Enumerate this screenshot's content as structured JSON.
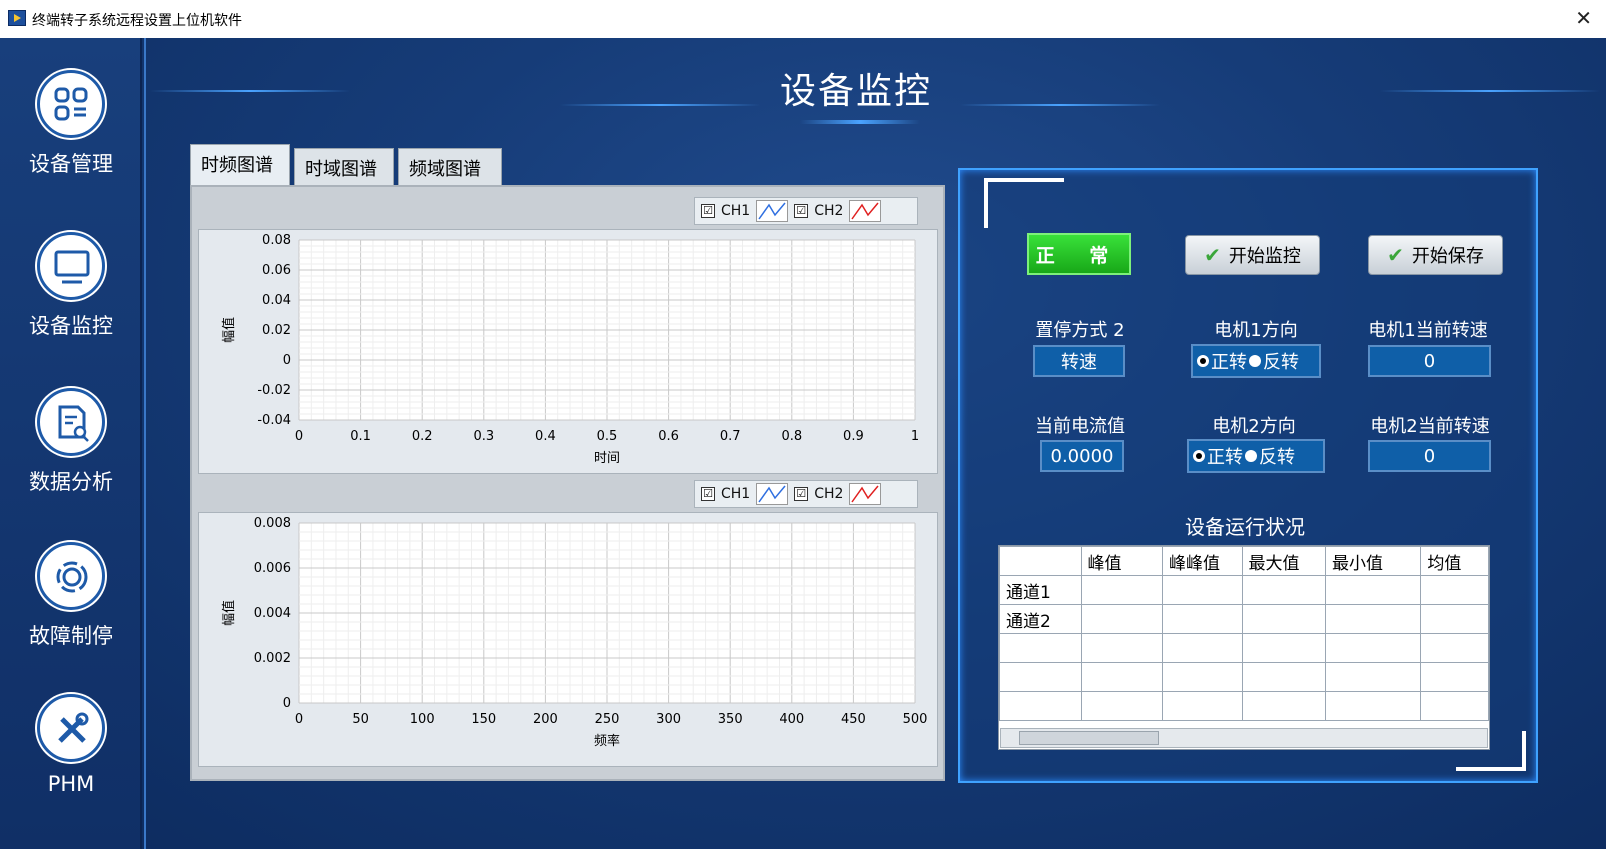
{
  "window": {
    "title": "终端转子系统远程设置上位机软件",
    "close": "✕"
  },
  "sidebar": {
    "items": [
      {
        "label": "设备管理",
        "icon": "apps-grid-icon"
      },
      {
        "label": "设备监控",
        "icon": "monitor-icon"
      },
      {
        "label": "数据分析",
        "icon": "document-search-icon"
      },
      {
        "label": "故障制停",
        "icon": "ring-icon"
      },
      {
        "label": "PHM",
        "icon": "tools-icon"
      }
    ]
  },
  "header": {
    "title": "设备监控"
  },
  "tabs": [
    {
      "label": "时频图谱",
      "active": true
    },
    {
      "label": "时域图谱"
    },
    {
      "label": "频域图谱"
    }
  ],
  "chart_data": [
    {
      "type": "line",
      "title": "",
      "xlabel": "时间",
      "ylabel": "幅值",
      "x_ticks": [
        "0",
        "0.1",
        "0.2",
        "0.3",
        "0.4",
        "0.5",
        "0.6",
        "0.7",
        "0.8",
        "0.9",
        "1"
      ],
      "y_ticks": [
        "0.08",
        "0.06",
        "0.04",
        "0.02",
        "0",
        "-0.02",
        "-0.04"
      ],
      "xlim": [
        0,
        1
      ],
      "ylim": [
        -0.04,
        0.08
      ],
      "grid": true,
      "legend": [
        {
          "name": "CH1",
          "checked": true,
          "color": "#2f6fe0"
        },
        {
          "name": "CH2",
          "checked": true,
          "color": "#e02020"
        }
      ],
      "series": []
    },
    {
      "type": "line",
      "title": "",
      "xlabel": "频率",
      "ylabel": "幅值",
      "x_ticks": [
        "0",
        "50",
        "100",
        "150",
        "200",
        "250",
        "300",
        "350",
        "400",
        "450",
        "500"
      ],
      "y_ticks": [
        "0.008",
        "0.006",
        "0.004",
        "0.002",
        "0"
      ],
      "xlim": [
        0,
        500
      ],
      "ylim": [
        0,
        0.008
      ],
      "grid": true,
      "legend": [
        {
          "name": "CH1",
          "checked": true,
          "color": "#2f6fe0"
        },
        {
          "name": "CH2",
          "checked": true,
          "color": "#e02020"
        }
      ],
      "series": []
    }
  ],
  "legend_check": "☑",
  "panel": {
    "status": "正 常",
    "start_monitor": "开始监控",
    "start_save": "开始保存",
    "stop_mode_label": "置停方式 2",
    "stop_mode_value": "转速",
    "motor1_dir_label": "电机1方向",
    "motor1_speed_label": "电机1当前转速",
    "motor1_speed": "0",
    "current_label": "当前电流值",
    "current_value": "0.0000",
    "motor2_dir_label": "电机2方向",
    "motor2_speed_label": "电机2当前转速",
    "motor2_speed": "0",
    "dir_forward": "正转",
    "dir_reverse": "反转",
    "table_title": "设备运行状况",
    "table_headers": [
      "",
      "峰值",
      "峰峰值",
      "最大值",
      "最小值",
      "均值"
    ],
    "table_rows": [
      [
        "通道1",
        "",
        "",
        "",
        "",
        ""
      ],
      [
        "通道2",
        "",
        "",
        "",
        "",
        ""
      ],
      [
        "",
        "",
        "",
        "",
        "",
        ""
      ],
      [
        "",
        "",
        "",
        "",
        "",
        ""
      ],
      [
        "",
        "",
        "",
        "",
        "",
        ""
      ]
    ]
  }
}
